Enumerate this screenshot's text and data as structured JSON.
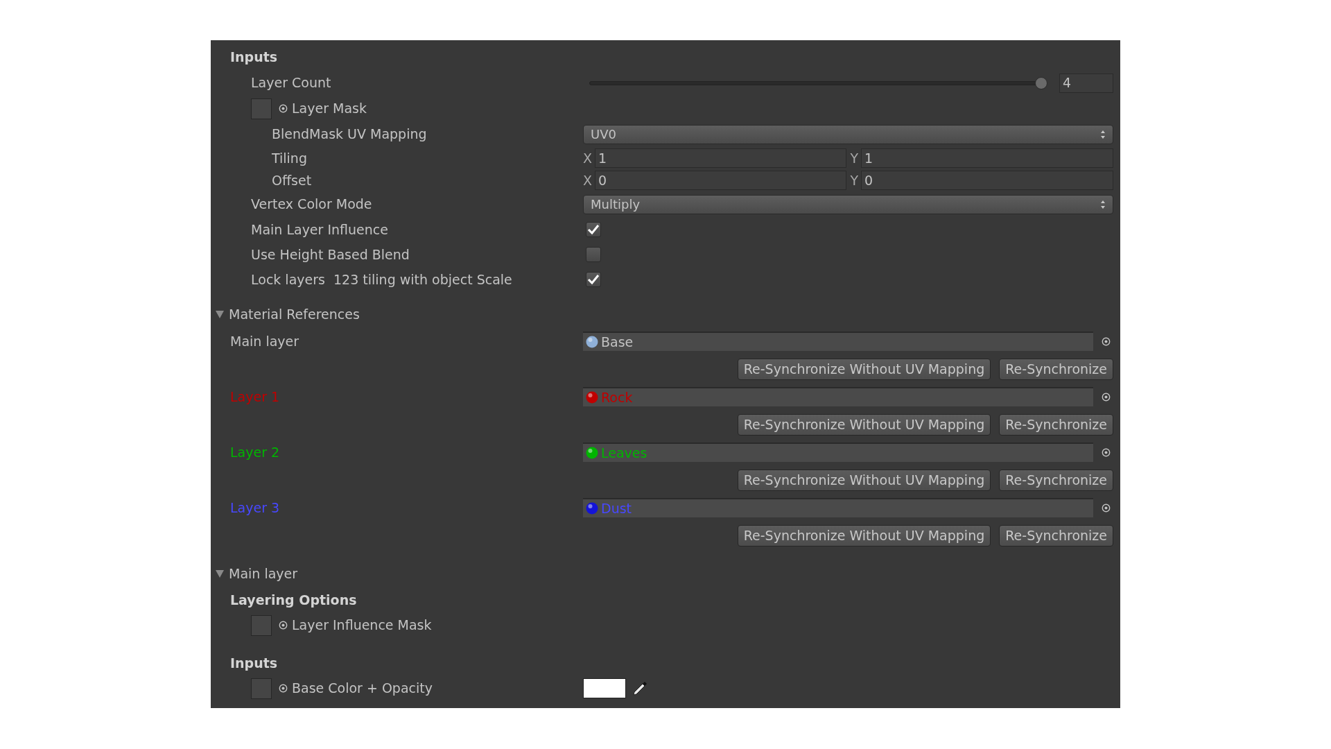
{
  "inputs": {
    "title": "Inputs",
    "fields": [
      {
        "kind": "slider",
        "label": "Layer Count",
        "level": 1,
        "value": "4"
      },
      {
        "kind": "texture",
        "label": "Layer Mask",
        "children": [
          {
            "kind": "dropdown",
            "label": "BlendMask UV Mapping",
            "value": "UV0"
          },
          {
            "kind": "vector",
            "label": "Tiling",
            "components": [
              {
                "axis": "X",
                "value": "1"
              },
              {
                "axis": "Y",
                "value": "1"
              }
            ]
          },
          {
            "kind": "vector",
            "label": "Offset",
            "components": [
              {
                "axis": "X",
                "value": "0"
              },
              {
                "axis": "Y",
                "value": "0"
              }
            ]
          }
        ]
      },
      {
        "kind": "dropdown",
        "label": "Vertex Color Mode",
        "value": "Multiply"
      },
      {
        "kind": "checkbox",
        "label": "Main Layer Influence",
        "checked": true
      },
      {
        "kind": "checkbox",
        "label": "Use Height Based Blend",
        "checked": false
      },
      {
        "kind": "checkbox",
        "label": "Lock layers  123 tiling with object Scale",
        "checked": true
      }
    ]
  },
  "material_references": {
    "title": "Material References",
    "expanded": true,
    "layers": [
      {
        "label": "Main layer",
        "material": "Base",
        "color": "#c2c2c2",
        "sphere": {
          "color": "#8fb0d8"
        },
        "buttons": [
          "Re-Synchronize Without UV Mapping",
          "Re-Synchronize"
        ]
      },
      {
        "label": "Layer 1",
        "material": "Rock",
        "color": "#c00000",
        "sphere": {
          "color": "#c00000"
        },
        "buttons": [
          "Re-Synchronize Without UV Mapping",
          "Re-Synchronize"
        ]
      },
      {
        "label": "Layer 2",
        "material": "Leaves",
        "color": "#00b400",
        "sphere": {
          "color": "#00b400"
        },
        "buttons": [
          "Re-Synchronize Without UV Mapping",
          "Re-Synchronize"
        ]
      },
      {
        "label": "Layer 3",
        "material": "Dust",
        "color": "#4848ff",
        "sphere": {
          "color": "#1414d8"
        },
        "buttons": [
          "Re-Synchronize Without UV Mapping",
          "Re-Synchronize"
        ]
      }
    ]
  },
  "main_layer": {
    "title": "Main layer",
    "expanded": true,
    "groups": [
      {
        "title": "Layering Options",
        "fields": [
          {
            "kind": "texture",
            "label": "Layer Influence Mask"
          }
        ]
      },
      {
        "title": "Inputs",
        "fields": [
          {
            "kind": "color",
            "label": "Base Color + Opacity",
            "color": "#ffffff"
          }
        ]
      }
    ]
  }
}
